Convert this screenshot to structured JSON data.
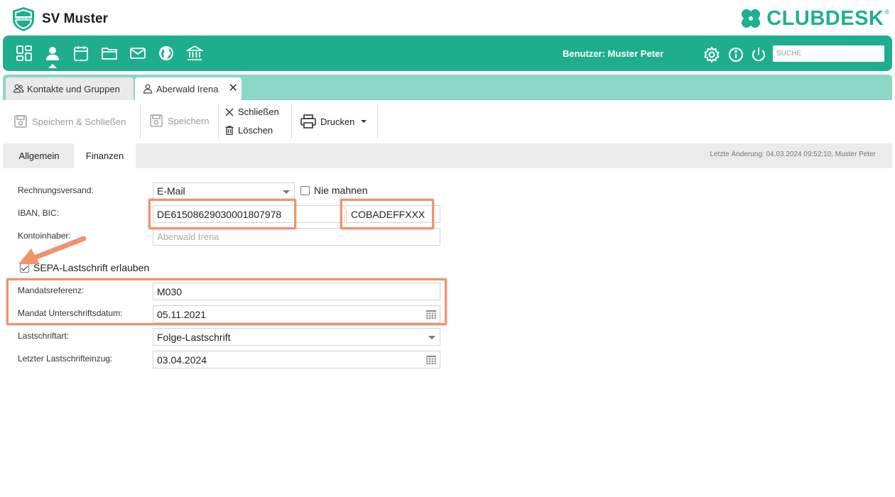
{
  "header": {
    "club_name": "SV Muster",
    "logo_text": "SV MUSTER",
    "brand": "CLUBDESK",
    "brand_reg": "®"
  },
  "nav": {
    "icons": [
      "dashboard-icon",
      "contacts-icon",
      "calendar-icon",
      "folder-icon",
      "mail-icon",
      "globe-icon",
      "bank-icon"
    ],
    "active": "contacts-icon",
    "user_label": "Benutzer: Muster Peter",
    "search_placeholder": "SUCHE"
  },
  "tabs": [
    {
      "label": "Kontakte und Gruppen",
      "icon": "group-icon"
    },
    {
      "label": "Aberwald Irena",
      "icon": "person-icon",
      "active": true
    }
  ],
  "toolbar": {
    "save_close": "Speichern & Schließen",
    "save": "Speichern",
    "close": "Schließen",
    "delete": "Löschen",
    "print": "Drucken"
  },
  "subtabs": {
    "general": "Allgemein",
    "finance": "Finanzen",
    "last_change": "Letzte Änderung: 04.03.2024 09:52:10, Muster Peter"
  },
  "form": {
    "invoice_delivery_label": "Rechnungsversand:",
    "invoice_delivery_value": "E-Mail",
    "never_remind_label": "Nie mahnen",
    "never_remind_checked": false,
    "iban_bic_label": "IBAN, BIC:",
    "iban_value": "DE61508629030001807978",
    "bic_value": "COBADEFFXXX",
    "account_holder_label": "Kontoinhaber:",
    "account_holder_placeholder": "Aberwald Irena",
    "sepa_label": "SEPA-Lastschrift erlauben",
    "sepa_checked": true,
    "mandate_ref_label": "Mandatsreferenz:",
    "mandate_ref_value": "M030",
    "mandate_date_label": "Mandat Unterschriftsdatum:",
    "mandate_date_value": "05.11.2021",
    "debit_type_label": "Lastschriftart:",
    "debit_type_value": "Folge-Lastschrift",
    "last_debit_label": "Letzter Lastschrifteinzug:",
    "last_debit_value": "03.04.2024"
  },
  "colors": {
    "accent": "#1fae8d",
    "tab_strip": "#8cd6c5",
    "annotation": "#f0926c"
  }
}
